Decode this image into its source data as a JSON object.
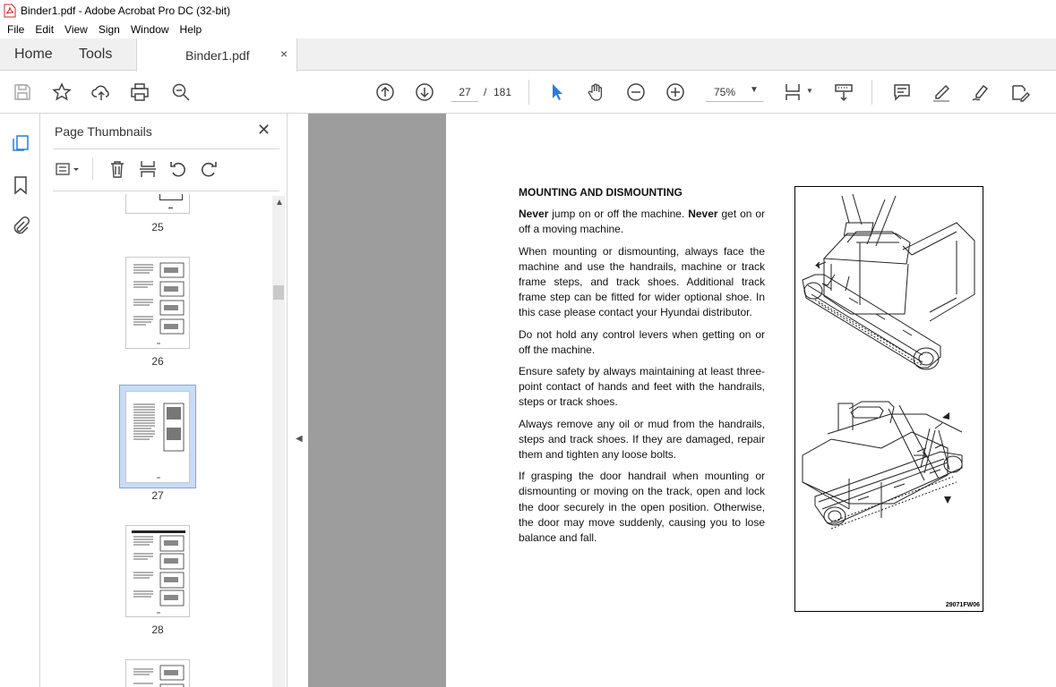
{
  "window": {
    "title": "Binder1.pdf - Adobe Acrobat Pro DC (32-bit)"
  },
  "menu": [
    "File",
    "Edit",
    "View",
    "Sign",
    "Window",
    "Help"
  ],
  "tabs": {
    "home": "Home",
    "tools": "Tools",
    "document": "Binder1.pdf",
    "close": "×"
  },
  "toolbar": {
    "current_page": "27",
    "page_separator": "/",
    "total_pages": "181",
    "zoom": "75%",
    "icons": [
      "save-icon",
      "bookmark-star-icon",
      "upload-icon",
      "print-icon",
      "search-zoom-icon",
      "page-up-icon",
      "page-down-icon",
      "select-cursor-icon",
      "hand-icon",
      "zoom-out-icon",
      "zoom-in-icon",
      "page-fit-icon",
      "scroll-mode-icon",
      "comment-icon",
      "highlight-icon",
      "sign-icon",
      "edit-icon"
    ]
  },
  "rail": {
    "icons": [
      "page-thumbnails-icon",
      "bookmark-icon",
      "attachment-icon"
    ]
  },
  "panel": {
    "title": "Page Thumbnails",
    "close": "✕",
    "thumbnails": [
      {
        "label": "25",
        "selected": false
      },
      {
        "label": "26",
        "selected": false
      },
      {
        "label": "27",
        "selected": true
      },
      {
        "label": "28",
        "selected": false
      }
    ]
  },
  "document": {
    "heading": "MOUNTING AND DISMOUNTING",
    "p1_bold1": "Never",
    "p1_text1": " jump on or off the machine. ",
    "p1_bold2": "Never",
    "p1_text2": " get on or off a moving machine.",
    "p2": "When mounting or dismounting, always face the machine and use the handrails, machine or track frame steps, and track shoes. Additional track frame step can be fitted for wider optional shoe.  In this case please contact your Hyundai distributor.",
    "p3": "Do not hold any control levers when getting on or off the machine.",
    "p4": "Ensure safety by always maintaining at least three-point contact of hands and feet with the handrails, steps or track shoes.",
    "p5": "Always remove any oil or mud from the handrails, steps and track shoes.  If they are damaged, repair them and tighten any loose bolts.",
    "p6": "If grasping the door handrail when mounting or dismounting or moving on the track, open and lock the door securely in the open position.  Otherwise, the door may move suddenly, causing you to lose balance and fall.",
    "figure_code": "29071FW06"
  },
  "colors": {
    "accent": "#2d7ad6",
    "chrome": "#f0f0f0",
    "workspace": "#9d9d9d"
  }
}
